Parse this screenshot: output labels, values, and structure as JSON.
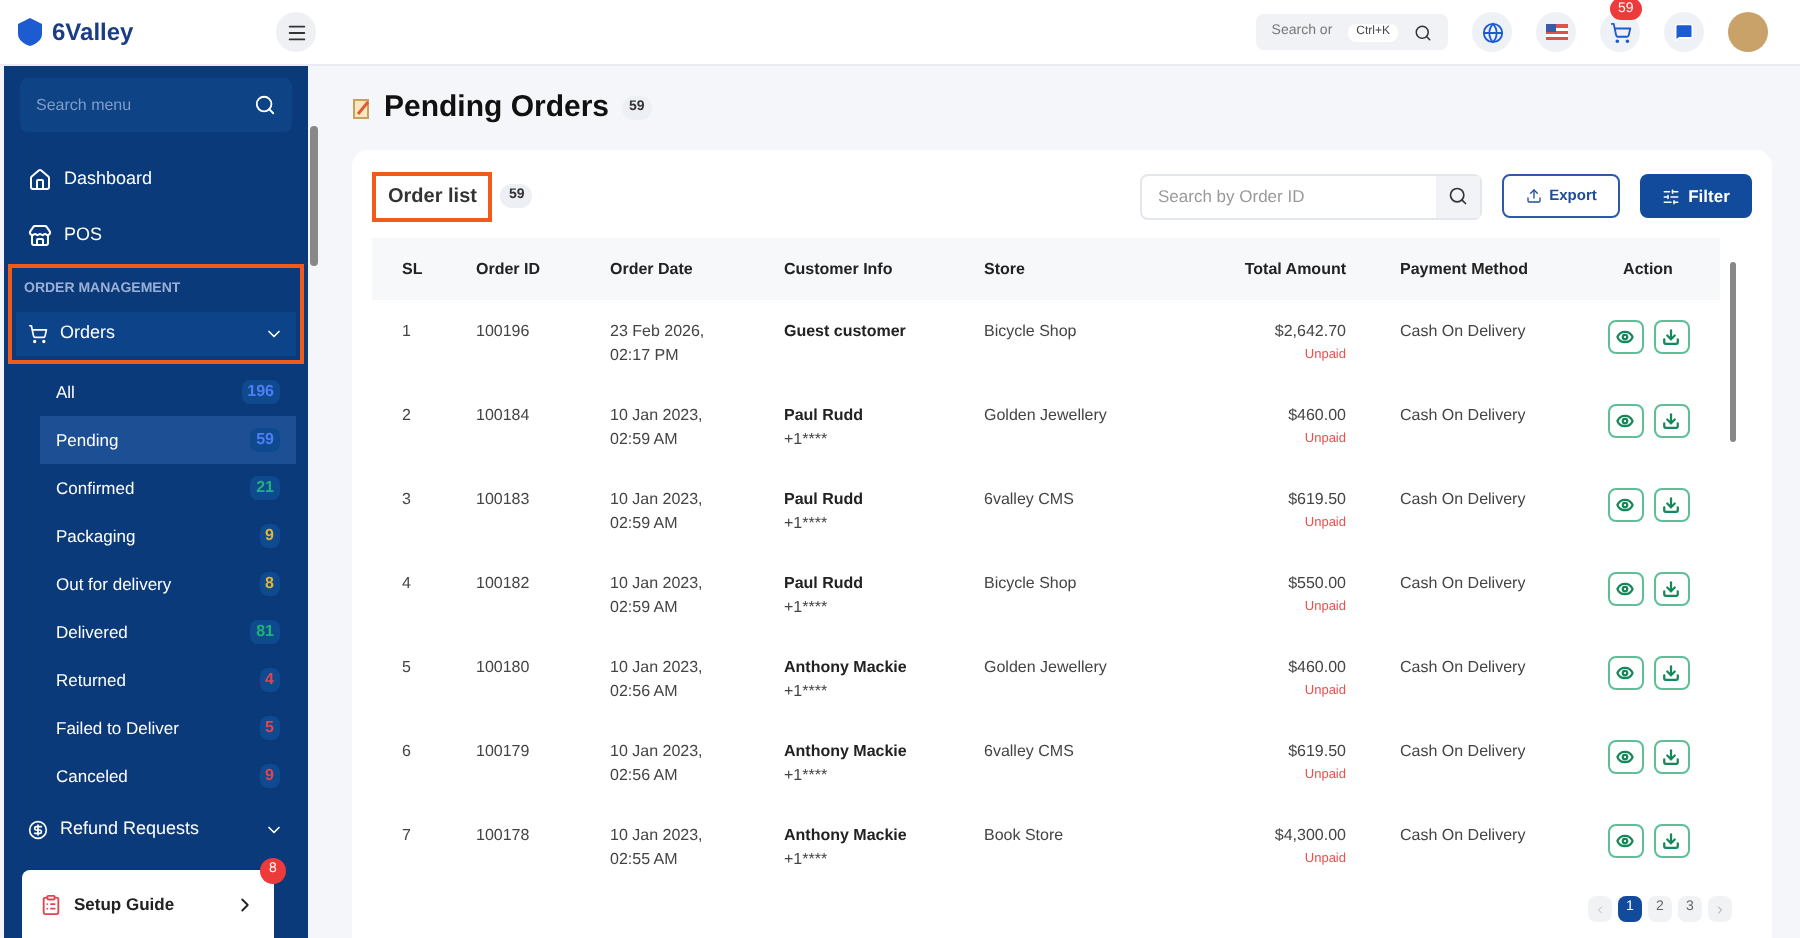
{
  "brand": {
    "name": "6Valley"
  },
  "topbar": {
    "search_placeholder": "Search or",
    "shortcut": "Ctrl+K",
    "cart_count": "59"
  },
  "sidebar": {
    "search_placeholder": "Search menu",
    "items": [
      {
        "label": "Dashboard",
        "kind": "home"
      },
      {
        "label": "POS",
        "kind": "pos"
      }
    ],
    "section": {
      "label": "ORDER MANAGEMENT",
      "highlighted": true
    },
    "orders": {
      "label": "Orders",
      "expanded": true,
      "children": [
        {
          "label": "All",
          "count": "196",
          "color": "#4f7df5",
          "selected": false
        },
        {
          "label": "Pending",
          "count": "59",
          "color": "#4f7df5",
          "selected": true
        },
        {
          "label": "Confirmed",
          "count": "21",
          "color": "#1fb37a",
          "selected": false
        },
        {
          "label": "Packaging",
          "count": "9",
          "color": "#e0b43a",
          "selected": false
        },
        {
          "label": "Out for delivery",
          "count": "8",
          "color": "#e0b43a",
          "selected": false
        },
        {
          "label": "Delivered",
          "count": "81",
          "color": "#1fb37a",
          "selected": false
        },
        {
          "label": "Returned",
          "count": "4",
          "color": "#e0444e",
          "selected": false
        },
        {
          "label": "Failed to Deliver",
          "count": "5",
          "color": "#e0444e",
          "selected": false
        },
        {
          "label": "Canceled",
          "count": "9",
          "color": "#e0444e",
          "selected": false
        }
      ]
    },
    "refund": {
      "label": "Refund Requests",
      "expanded": false
    },
    "setup_guide": {
      "label": "Setup Guide",
      "badge": "8"
    }
  },
  "page": {
    "title": "Pending Orders",
    "count": "59"
  },
  "order_list": {
    "title": "Order list",
    "count": "59",
    "highlighted": true,
    "search_placeholder": "Search by Order ID",
    "export_label": "Export",
    "filter_label": "Filter"
  },
  "table": {
    "columns": [
      "SL",
      "Order ID",
      "Order Date",
      "Customer Info",
      "Store",
      "Total Amount",
      "Payment Method",
      "Action"
    ],
    "rows": [
      {
        "sl": "1",
        "order_id": "100196",
        "date": "23 Feb 2026,",
        "time": "02:17 PM",
        "customer": "Guest customer",
        "store": "Bicycle Shop",
        "amount": "$2,642.70",
        "payment_status": "Unpaid",
        "method": "Cash On Delivery"
      },
      {
        "sl": "2",
        "order_id": "100184",
        "date": "10 Jan 2023,",
        "time": "02:59 AM",
        "customer": "Paul Rudd",
        "phone": "+1****",
        "store": "Golden Jewellery",
        "amount": "$460.00",
        "payment_status": "Unpaid",
        "method": "Cash On Delivery"
      },
      {
        "sl": "3",
        "order_id": "100183",
        "date": "10 Jan 2023,",
        "time": "02:59 AM",
        "customer": "Paul Rudd",
        "phone": "+1****",
        "store": "6valley CMS",
        "amount": "$619.50",
        "payment_status": "Unpaid",
        "method": "Cash On Delivery"
      },
      {
        "sl": "4",
        "order_id": "100182",
        "date": "10 Jan 2023,",
        "time": "02:59 AM",
        "customer": "Paul Rudd",
        "phone": "+1****",
        "store": "Bicycle Shop",
        "amount": "$550.00",
        "payment_status": "Unpaid",
        "method": "Cash On Delivery"
      },
      {
        "sl": "5",
        "order_id": "100180",
        "date": "10 Jan 2023,",
        "time": "02:56 AM",
        "customer": "Anthony Mackie",
        "phone": "+1****",
        "store": "Golden Jewellery",
        "amount": "$460.00",
        "payment_status": "Unpaid",
        "method": "Cash On Delivery"
      },
      {
        "sl": "6",
        "order_id": "100179",
        "date": "10 Jan 2023,",
        "time": "02:56 AM",
        "customer": "Anthony Mackie",
        "phone": "+1****",
        "store": "6valley CMS",
        "amount": "$619.50",
        "payment_status": "Unpaid",
        "method": "Cash On Delivery"
      },
      {
        "sl": "7",
        "order_id": "100178",
        "date": "10 Jan 2023,",
        "time": "02:55 AM",
        "customer": "Anthony Mackie",
        "phone": "+1****",
        "store": "Book Store",
        "amount": "$4,300.00",
        "payment_status": "Unpaid",
        "method": "Cash On Delivery"
      }
    ]
  },
  "pagination": {
    "pages": [
      {
        "label": "1",
        "selected": true
      },
      {
        "label": "2",
        "selected": false
      },
      {
        "label": "3",
        "selected": false
      }
    ]
  }
}
